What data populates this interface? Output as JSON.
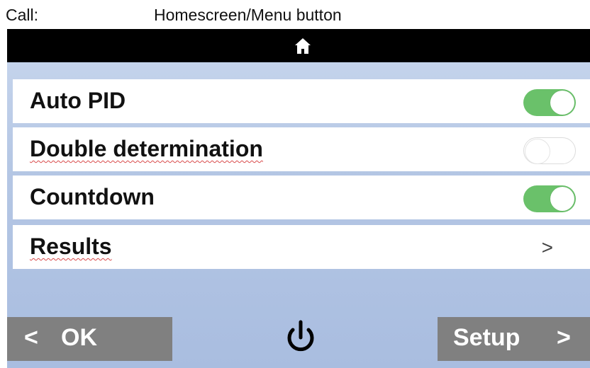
{
  "caption": {
    "label": "Call:",
    "value": "Homescreen/Menu button"
  },
  "topbar": {
    "icon": "home-icon"
  },
  "menu": {
    "items": [
      {
        "label": "Auto PID",
        "control": "toggle",
        "state": "on"
      },
      {
        "label": "Double determination",
        "control": "toggle",
        "state": "off"
      },
      {
        "label": "Countdown",
        "control": "toggle",
        "state": "on"
      },
      {
        "label": "Results",
        "control": "chevron",
        "chevron": ">"
      }
    ]
  },
  "footer": {
    "ok": {
      "arrow": "<",
      "label": "OK"
    },
    "power": {
      "icon": "power-icon"
    },
    "setup": {
      "label": "Setup",
      "arrow": ">"
    }
  },
  "colors": {
    "toggle_on": "#6ac16a",
    "topbar": "#000000",
    "nav_button": "#808080",
    "background": "#b5c7e4"
  }
}
